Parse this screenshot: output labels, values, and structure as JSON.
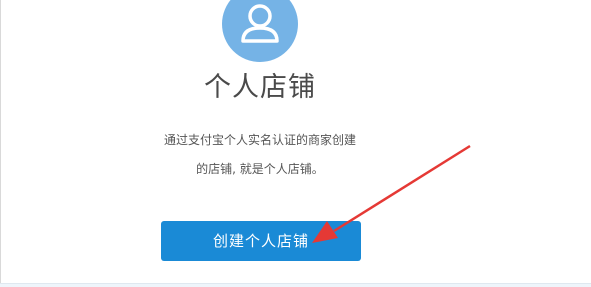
{
  "store": {
    "title": "个人店铺",
    "description_line1": "通过支付宝个人实名认证的商家创建",
    "description_line2": "的店铺, 就是个人店铺。",
    "button_label": "创建个人店铺",
    "icon": "user-icon"
  },
  "colors": {
    "accent": "#1a8ad6",
    "avatar_bg": "#75b3e6",
    "annotation_arrow": "#e53935"
  }
}
